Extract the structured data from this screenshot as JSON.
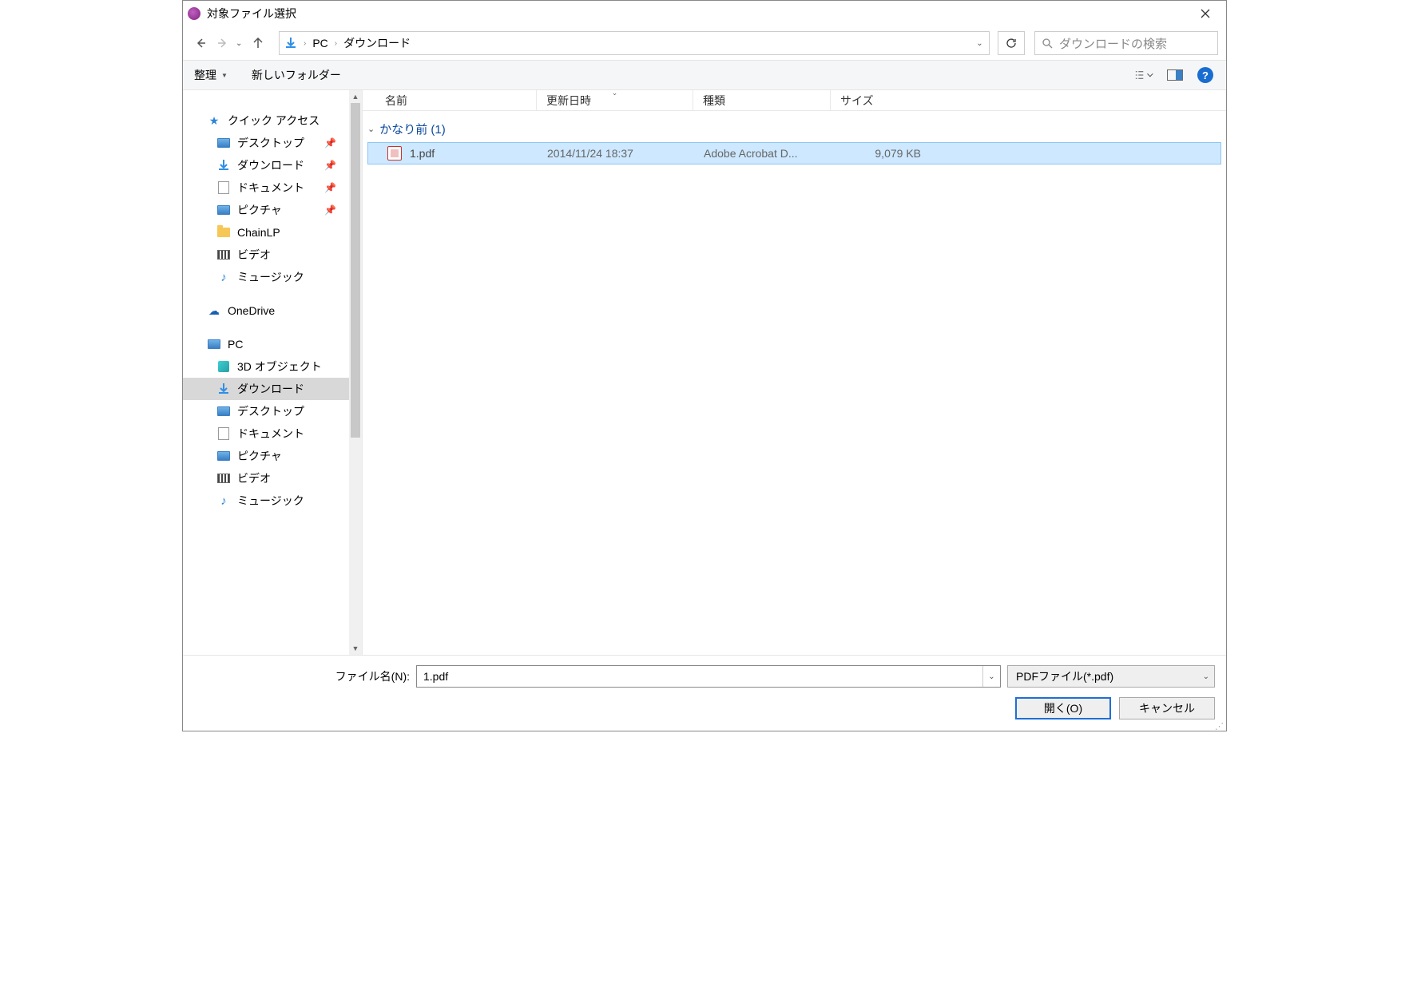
{
  "title": "対象ファイル選択",
  "breadcrumb": {
    "root": "PC",
    "folder": "ダウンロード"
  },
  "search_placeholder": "ダウンロードの検索",
  "toolbar": {
    "organize": "整理",
    "newfolder": "新しいフォルダー"
  },
  "columns": {
    "name": "名前",
    "date": "更新日時",
    "kind": "種類",
    "size": "サイズ"
  },
  "sidebar": {
    "quick_access": "クイック アクセス",
    "items_top": [
      {
        "label": "デスクトップ",
        "icon": "desktop",
        "pin": true
      },
      {
        "label": "ダウンロード",
        "icon": "download",
        "pin": true
      },
      {
        "label": "ドキュメント",
        "icon": "doc",
        "pin": true
      },
      {
        "label": "ピクチャ",
        "icon": "picture",
        "pin": true
      },
      {
        "label": "ChainLP",
        "icon": "folder",
        "pin": false
      },
      {
        "label": "ビデオ",
        "icon": "video",
        "pin": false
      },
      {
        "label": "ミュージック",
        "icon": "music",
        "pin": false
      }
    ],
    "onedrive": "OneDrive",
    "pc": "PC",
    "items_pc": [
      {
        "label": "3D オブジェクト",
        "icon": "3d"
      },
      {
        "label": "ダウンロード",
        "icon": "download",
        "selected": true
      },
      {
        "label": "デスクトップ",
        "icon": "desktop"
      },
      {
        "label": "ドキュメント",
        "icon": "doc"
      },
      {
        "label": "ピクチャ",
        "icon": "picture"
      },
      {
        "label": "ビデオ",
        "icon": "video"
      },
      {
        "label": "ミュージック",
        "icon": "music"
      }
    ]
  },
  "group_header": "かなり前 (1)",
  "file": {
    "name": "1.pdf",
    "date": "2014/11/24 18:37",
    "kind": "Adobe Acrobat D...",
    "size": "9,079 KB"
  },
  "bottom": {
    "filename_label": "ファイル名(N):",
    "filename_value": "1.pdf",
    "filter": "PDFファイル(*.pdf)",
    "open": "開く(O)",
    "cancel": "キャンセル"
  }
}
